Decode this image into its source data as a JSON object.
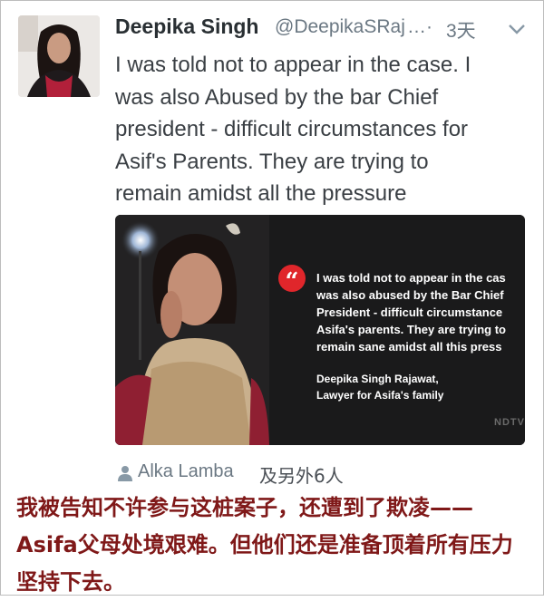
{
  "tweet": {
    "author_name": "Deepika Singh",
    "handle": "@DeepikaSRaj",
    "handle_overflow": "…",
    "separator": "·",
    "time": "3天",
    "text": "I was told not to appear in the case. I\nwas also Abused by the bar Chief\npresident - difficult circumstances for\nAsif's Parents. They are trying to\nremain amidst all the pressure"
  },
  "media": {
    "quote_mark": "“",
    "quote_text": "I was told not to appear in the cas\nwas also abused by the Bar Chief\nPresident - difficult circumstance\nAsifa's parents. They are trying to\nremain sane amidst all this press",
    "attribution": "Deepika Singh Rajawat,\nLawyer for Asifa's family",
    "watermark": "NDTV",
    "accent_color": "#e0262b"
  },
  "retweet": {
    "icon": "person-icon",
    "name": "Alka Lamba",
    "others": "及另外6人"
  },
  "caption": "我被告知不许参与这桩案子，还遭到了欺凌——Asifa父母处境艰难。但他们还是准备顶着所有压力坚持下去。",
  "colors": {
    "caption": "#7f1818",
    "meta_text": "#6b7883",
    "body_text": "#3a3f44"
  }
}
